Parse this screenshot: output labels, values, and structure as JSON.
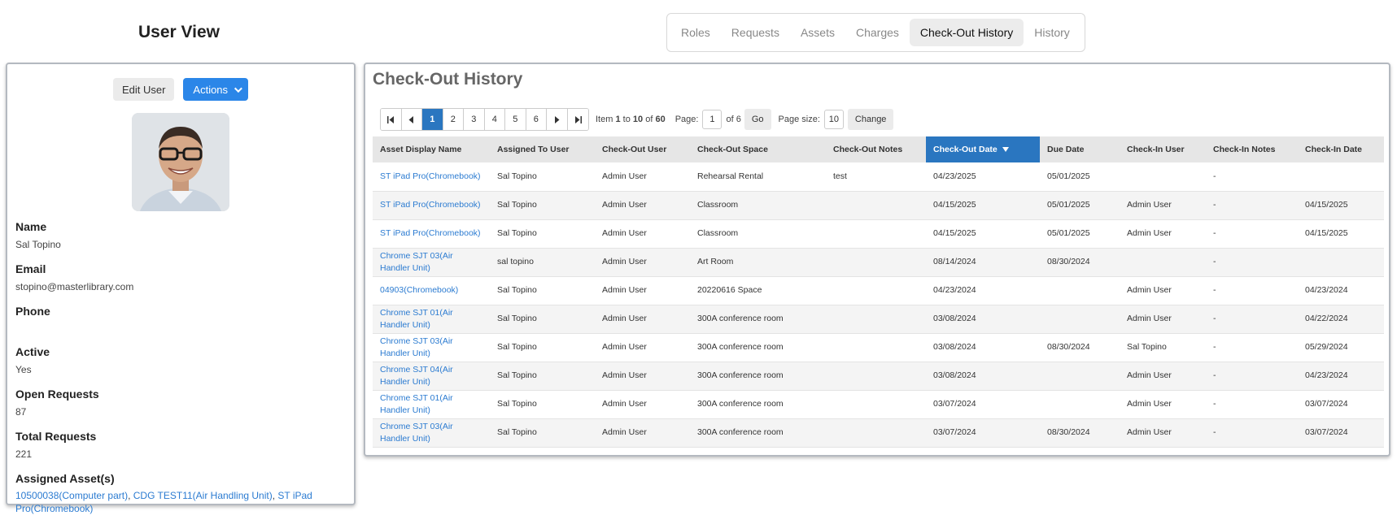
{
  "page": {
    "title": "User View"
  },
  "tabs": [
    {
      "label": "Roles",
      "active": false
    },
    {
      "label": "Requests",
      "active": false
    },
    {
      "label": "Assets",
      "active": false
    },
    {
      "label": "Charges",
      "active": false
    },
    {
      "label": "Check-Out History",
      "active": true
    },
    {
      "label": "History",
      "active": false
    }
  ],
  "user_card": {
    "edit_label": "Edit User",
    "actions_label": "Actions",
    "fields": {
      "name_label": "Name",
      "name_value": "Sal Topino",
      "email_label": "Email",
      "email_value": "stopino@masterlibrary.com",
      "phone_label": "Phone",
      "phone_value": "",
      "active_label": "Active",
      "active_value": "Yes",
      "open_requests_label": "Open Requests",
      "open_requests_value": "87",
      "total_requests_label": "Total Requests",
      "total_requests_value": "221",
      "assets_label": "Assigned Asset(s)"
    },
    "assets": [
      "10500038(Computer part)",
      "CDG TEST11(Air Handling Unit)",
      "ST iPad Pro(Chromebook)"
    ]
  },
  "history": {
    "title": "Check-Out History",
    "pager": {
      "first_icon": "first-page-icon",
      "prev_icon": "prev-page-icon",
      "pages": [
        "1",
        "2",
        "3",
        "4",
        "5",
        "6"
      ],
      "active_page": "1",
      "next_icon": "next-page-icon",
      "last_icon": "last-page-icon",
      "item_prefix": "Item",
      "item_from": "1",
      "item_to_word": "to",
      "item_to": "10",
      "item_of_word": "of",
      "item_total": "60",
      "page_label": "Page:",
      "page_value": "1",
      "page_of": "of 6",
      "go_label": "Go",
      "size_label": "Page size:",
      "size_value": "10",
      "change_label": "Change"
    },
    "columns": [
      "Asset Display Name",
      "Assigned To User",
      "Check-Out User",
      "Check-Out Space",
      "Check-Out Notes",
      "Check-Out Date",
      "Due Date",
      "Check-In User",
      "Check-In Notes",
      "Check-In Date"
    ],
    "sorted_column": "Check-Out Date",
    "rows": [
      [
        "ST iPad Pro(Chromebook)",
        "Sal Topino",
        "Admin User",
        "Rehearsal Rental",
        "test",
        "04/23/2025",
        "05/01/2025",
        "",
        "-",
        ""
      ],
      [
        "ST iPad Pro(Chromebook)",
        "Sal Topino",
        "Admin User",
        "Classroom",
        "",
        "04/15/2025",
        "05/01/2025",
        "Admin User",
        "-",
        "04/15/2025"
      ],
      [
        "ST iPad Pro(Chromebook)",
        "Sal Topino",
        "Admin User",
        "Classroom",
        "",
        "04/15/2025",
        "05/01/2025",
        "Admin User",
        "-",
        "04/15/2025"
      ],
      [
        "Chrome SJT 03(Air Handler Unit)",
        "sal topino",
        "Admin User",
        "Art Room",
        "",
        "08/14/2024",
        "08/30/2024",
        "",
        "-",
        ""
      ],
      [
        "04903(Chromebook)",
        "Sal Topino",
        "Admin User",
        "20220616 Space",
        "",
        "04/23/2024",
        "",
        "Admin User",
        "-",
        "04/23/2024"
      ],
      [
        "Chrome SJT 01(Air Handler Unit)",
        "Sal Topino",
        "Admin User",
        "300A conference room",
        "",
        "03/08/2024",
        "",
        "Admin User",
        "-",
        "04/22/2024"
      ],
      [
        "Chrome SJT 03(Air Handler Unit)",
        "Sal Topino",
        "Admin User",
        "300A conference room",
        "",
        "03/08/2024",
        "08/30/2024",
        "Sal Topino",
        "-",
        "05/29/2024"
      ],
      [
        "Chrome SJT 04(Air Handler Unit)",
        "Sal Topino",
        "Admin User",
        "300A conference room",
        "",
        "03/08/2024",
        "",
        "Admin User",
        "-",
        "04/23/2024"
      ],
      [
        "Chrome SJT 01(Air Handler Unit)",
        "Sal Topino",
        "Admin User",
        "300A conference room",
        "",
        "03/07/2024",
        "",
        "Admin User",
        "-",
        "03/07/2024"
      ],
      [
        "Chrome SJT 03(Air Handler Unit)",
        "Sal Topino",
        "Admin User",
        "300A conference room",
        "",
        "03/07/2024",
        "08/30/2024",
        "Admin User",
        "-",
        "03/07/2024"
      ]
    ]
  },
  "colors": {
    "accent": "#2b86e8",
    "sorted_header": "#2a76c0",
    "link": "#2b7bd1"
  }
}
